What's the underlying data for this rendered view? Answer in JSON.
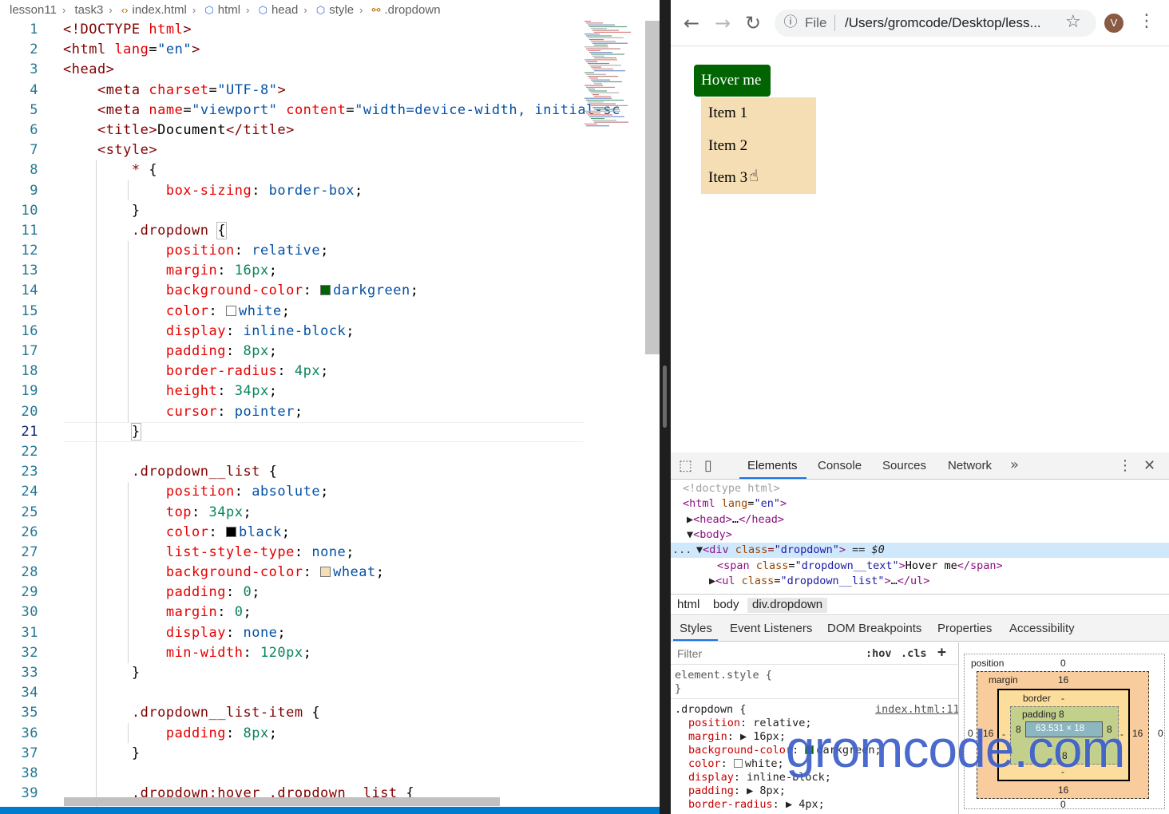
{
  "editor": {
    "breadcrumb": [
      "lesson11",
      "task3",
      "index.html",
      "html",
      "head",
      "style",
      ".dropdown"
    ],
    "lines": [
      {
        "n": "1",
        "html": "<span class='t'>&lt;!DOCTYPE</span> <span class='a'>html</span><span class='t'>&gt;</span>"
      },
      {
        "n": "2",
        "html": "<span class='t'>&lt;html</span> <span class='a'>lang</span>=<span class='s'>\"en\"</span><span class='t'>&gt;</span>"
      },
      {
        "n": "3",
        "html": "<span class='t'>&lt;head&gt;</span>"
      },
      {
        "n": "4",
        "html": "    <span class='t'>&lt;meta</span> <span class='a'>charset</span>=<span class='s'>\"UTF-8\"</span><span class='t'>&gt;</span>"
      },
      {
        "n": "5",
        "html": "    <span class='t'>&lt;meta</span> <span class='a'>name</span>=<span class='s'>\"viewport\"</span> <span class='a'>content</span>=<span class='s'>\"width=device-width, initial-sc</span>"
      },
      {
        "n": "6",
        "html": "    <span class='t'>&lt;title&gt;</span>Document<span class='t'>&lt;/title&gt;</span>"
      },
      {
        "n": "7",
        "html": "    <span class='t'>&lt;style&gt;</span>"
      },
      {
        "n": "8",
        "html": "        <span class='sel'>*</span> {"
      },
      {
        "n": "9",
        "html": "            <span class='p'>box-sizing</span>: <span class='v'>border-box</span>;"
      },
      {
        "n": "10",
        "html": "        }"
      },
      {
        "n": "11",
        "html": "        <span class='sel'>.dropdown</span> <span class='brk'>{</span>"
      },
      {
        "n": "12",
        "html": "            <span class='p'>position</span>: <span class='v'>relative</span>;"
      },
      {
        "n": "13",
        "html": "            <span class='p'>margin</span>: <span class='n'>16px</span>;"
      },
      {
        "n": "14",
        "html": "            <span class='p'>background-color</span>: <span class='sw' style='background:#006400'></span><span class='v'>darkgreen</span>;"
      },
      {
        "n": "15",
        "html": "            <span class='p'>color</span>: <span class='sw' style='background:#fff'></span><span class='v'>white</span>;"
      },
      {
        "n": "16",
        "html": "            <span class='p'>display</span>: <span class='v'>inline-block</span>;"
      },
      {
        "n": "17",
        "html": "            <span class='p'>padding</span>: <span class='n'>8px</span>;"
      },
      {
        "n": "18",
        "html": "            <span class='p'>border-radius</span>: <span class='n'>4px</span>;"
      },
      {
        "n": "19",
        "html": "            <span class='p'>height</span>: <span class='n'>34px</span>;"
      },
      {
        "n": "20",
        "html": "            <span class='p'>cursor</span>: <span class='v'>pointer</span>;"
      },
      {
        "n": "21",
        "html": "        <span class='brk'>}</span>"
      },
      {
        "n": "22",
        "html": ""
      },
      {
        "n": "23",
        "html": "        <span class='sel'>.dropdown__list</span> {"
      },
      {
        "n": "24",
        "html": "            <span class='p'>position</span>: <span class='v'>absolute</span>;"
      },
      {
        "n": "25",
        "html": "            <span class='p'>top</span>: <span class='n'>34px</span>;"
      },
      {
        "n": "26",
        "html": "            <span class='p'>color</span>: <span class='sw' style='background:#000'></span><span class='v'>black</span>;"
      },
      {
        "n": "27",
        "html": "            <span class='p'>list-style-type</span>: <span class='v'>none</span>;"
      },
      {
        "n": "28",
        "html": "            <span class='p'>background-color</span>: <span class='sw' style='background:#f5deb3'></span><span class='v'>wheat</span>;"
      },
      {
        "n": "29",
        "html": "            <span class='p'>padding</span>: <span class='n'>0</span>;"
      },
      {
        "n": "30",
        "html": "            <span class='p'>margin</span>: <span class='n'>0</span>;"
      },
      {
        "n": "31",
        "html": "            <span class='p'>display</span>: <span class='v'>none</span>;"
      },
      {
        "n": "32",
        "html": "            <span class='p'>min-width</span>: <span class='n'>120px</span>;"
      },
      {
        "n": "33",
        "html": "        }"
      },
      {
        "n": "34",
        "html": ""
      },
      {
        "n": "35",
        "html": "        <span class='sel'>.dropdown__list-item</span> {"
      },
      {
        "n": "36",
        "html": "            <span class='p'>padding</span>: <span class='n'>8px</span>;"
      },
      {
        "n": "37",
        "html": "        }"
      },
      {
        "n": "38",
        "html": ""
      },
      {
        "n": "39",
        "html": "        <span class='sel'>.dropdown:hover .dropdown__list</span> {"
      }
    ],
    "current_line": "21"
  },
  "browser": {
    "scheme_label": "File",
    "url": "/Users/gromcode/Desktop/less...",
    "avatar_letter": "V",
    "page": {
      "button_text": "Hover me",
      "items": [
        "Item 1",
        "Item 2",
        "Item 3"
      ]
    }
  },
  "devtools": {
    "tabs": [
      "Elements",
      "Console",
      "Sources",
      "Network"
    ],
    "active_tab": "Elements",
    "dom_lines": [
      {
        "html": "<span class='dg'>&lt;!doctype html&gt;</span>"
      },
      {
        "html": "<span class='dt'>&lt;html</span> <span class='da'>lang</span>=<span class='dv'>\"en\"</span><span class='dt'>&gt;</span>"
      },
      {
        "html": "<span class='dk'>▶</span><span class='dt'>&lt;head&gt;</span>…<span class='dt'>&lt;/head&gt;</span>"
      },
      {
        "html": "<span class='dk'>▼</span><span class='dt'>&lt;body&gt;</span>"
      },
      {
        "html": "<span class='dk'>▼</span><span class='dt'>&lt;div</span> <span class='da'>class</span>=<span class='dv'>\"dropdown\"</span><span class='dt'>&gt;</span> <span class='dk'>== </span><i class='dk'>$0</i>"
      },
      {
        "html": "<span class='dt'>&lt;span</span> <span class='da'>class</span>=<span class='dv'>\"dropdown__text\"</span><span class='dt'>&gt;</span>Hover me<span class='dt'>&lt;/span&gt;</span>"
      },
      {
        "html": "<span class='dk'>▶</span><span class='dt'>&lt;ul</span> <span class='da'>class</span>=<span class='dv'>\"dropdown__list\"</span><span class='dt'>&gt;</span>…<span class='dt'>&lt;/ul&gt;</span>"
      }
    ],
    "crumbs": [
      "html",
      "body",
      "div.dropdown"
    ],
    "styles_tabs": [
      "Styles",
      "Event Listeners",
      "DOM Breakpoints",
      "Properties",
      "Accessibility"
    ],
    "filter_placeholder": "Filter",
    "hov": ":hov",
    "cls": ".cls",
    "element_style": "element.style {",
    "element_style_close": "}",
    "rule_selector": ".dropdown {",
    "rule_source": "index.html:11",
    "rule_props": [
      {
        "p": "position",
        "v": "relative;"
      },
      {
        "p": "margin",
        "v": "▶ 16px;"
      },
      {
        "p": "background-color",
        "v": "darkgreen;"
      },
      {
        "p": "color",
        "v": "white;"
      },
      {
        "p": "display",
        "v": "inline-block;"
      },
      {
        "p": "padding",
        "v": "▶ 8px;"
      },
      {
        "p": "border-radius",
        "v": "▶ 4px;"
      }
    ],
    "box_model": {
      "position_label": "position",
      "position_top": "0",
      "position_bottom": "0",
      "position_left": "0",
      "position_right": "0",
      "margin_label": "margin",
      "margin_top": "16",
      "margin_bottom": "16",
      "margin_left": "16",
      "margin_right": "16",
      "border_label": "border",
      "border_top": "-",
      "border_bottom": "-",
      "border_left": "-",
      "border_right": "-",
      "padding_label": "padding 8",
      "padding_bottom": "8",
      "padding_left": "8",
      "padding_right": "8",
      "content": "63.531 × 18"
    }
  },
  "watermark": "gromcode.com"
}
